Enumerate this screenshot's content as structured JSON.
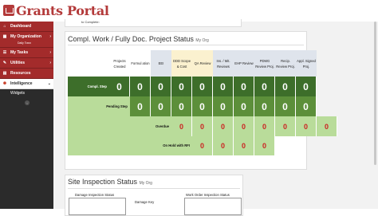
{
  "brand": {
    "name": "Grants Portal"
  },
  "sidebar": {
    "items": [
      {
        "label": "Dashboard",
        "icon": "home-icon"
      },
      {
        "label": "My Organization",
        "icon": "building-icon",
        "sub": "Daily Town"
      },
      {
        "label": "My Tasks",
        "icon": "tasks-icon"
      },
      {
        "label": "Utilities",
        "icon": "wrench-icon"
      },
      {
        "label": "Resources",
        "icon": "folder-icon"
      },
      {
        "label": "Intelligence",
        "icon": "lightbulb-icon"
      }
    ],
    "sub_items": [
      {
        "label": "Widgets"
      }
    ]
  },
  "top_card": {
    "text": "to Complete:"
  },
  "project_status": {
    "title": "Compl. Work / Fully Doc. Project Status",
    "org": "My Org",
    "columns": [
      "Projects Created",
      "Formul ation",
      "EEI",
      "DDD Scope & Cost",
      "QA Review",
      "Ins. / Mit. Reviews",
      "EHP Review",
      "PDMG Review Proj.",
      "Recip. Review Proj.",
      "Appl. Signed Proj."
    ],
    "rows": [
      {
        "label": "Compl. Step",
        "values": [
          "0",
          "0",
          "0",
          "0",
          "0",
          "0",
          "0",
          "0",
          "0",
          "0"
        ]
      },
      {
        "label": "Pending Step",
        "values": [
          "0",
          "0",
          "0",
          "0",
          "0",
          "0",
          "0",
          "0",
          "0"
        ]
      },
      {
        "label": "Overdue",
        "values": [
          "0",
          "0",
          "0",
          "0",
          "0",
          "0",
          "0",
          "0"
        ]
      },
      {
        "label": "On Hold with RFI",
        "values": [
          "0",
          "0",
          "0",
          "0"
        ]
      }
    ]
  },
  "site_inspection": {
    "title": "Site Inspection Status",
    "org": "My Org",
    "labels": [
      "Damage Inspection Status",
      "Damage Key",
      "Work Order Inspection Status"
    ]
  },
  "colors": {
    "brand_red": "#b33a3a",
    "dark_green": "#3d6e2a",
    "mid_green": "#5c8f3a",
    "light_green": "#b9dc9a",
    "overdue_red": "#cc2222",
    "hdr_blue": "#dfe4ec",
    "hdr_yellow": "#fbf1cf"
  }
}
